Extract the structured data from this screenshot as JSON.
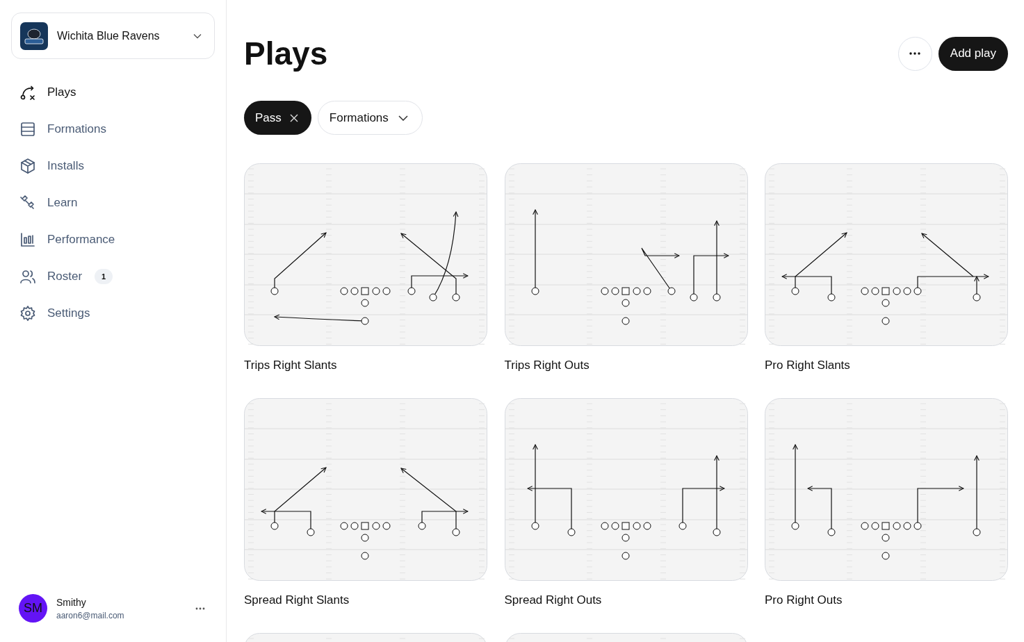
{
  "team_switcher": {
    "name": "Wichita Blue Ravens"
  },
  "nav": [
    {
      "label": "Plays",
      "selected": true
    },
    {
      "label": "Formations",
      "selected": false
    },
    {
      "label": "Installs",
      "selected": false
    },
    {
      "label": "Learn",
      "selected": false
    },
    {
      "label": "Performance",
      "selected": false
    },
    {
      "label": "Roster",
      "selected": false,
      "badge": "1"
    },
    {
      "label": "Settings",
      "selected": false
    }
  ],
  "user": {
    "initials": "SM",
    "name": "Smithy",
    "email": "aaron6@mail.com"
  },
  "page": {
    "title": "Plays",
    "add_button": "Add play"
  },
  "filters": [
    {
      "kind": "chip",
      "label": "Pass"
    },
    {
      "kind": "dropdown",
      "label": "Formations"
    }
  ],
  "plays": [
    {
      "kind": "full",
      "title": "Trips Right Slants"
    },
    {
      "kind": "full",
      "title": "Trips Right Outs"
    },
    {
      "kind": "full",
      "title": "Pro Right Slants"
    },
    {
      "kind": "full",
      "title": "Spread Right Slants"
    },
    {
      "kind": "full",
      "title": "Spread Right Outs"
    },
    {
      "kind": "full",
      "title": "Pro Right Outs"
    },
    {
      "kind": "partial"
    },
    {
      "kind": "partial"
    }
  ]
}
